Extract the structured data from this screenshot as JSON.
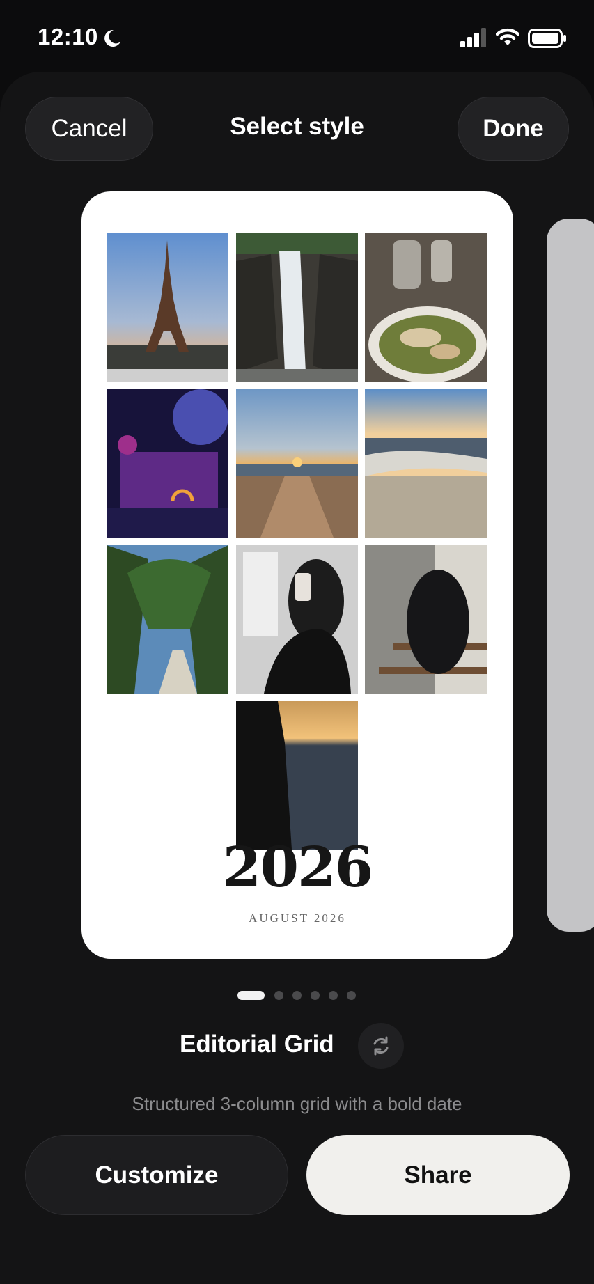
{
  "status": {
    "time": "12:10"
  },
  "header": {
    "cancel_label": "Cancel",
    "title": "Select style",
    "done_label": "Done"
  },
  "preview": {
    "year_text": "2026",
    "month_text": "AUGUST 2026",
    "photos": [
      "eiffel-tower-photo",
      "waterfall-photo",
      "dinner-salad-photo",
      "nightclub-photo",
      "beach-sunset-path-photo",
      "beach-waves-photo",
      "palm-path-photo",
      "mirror-selfie-photo",
      "staircase-portrait-photo",
      "sunset-silhouette-photo"
    ]
  },
  "pagination": {
    "count": 6,
    "active_index": 0
  },
  "style": {
    "name": "Editorial Grid",
    "description": "Structured 3-column grid with a bold date"
  },
  "actions": {
    "customize_label": "Customize",
    "share_label": "Share"
  },
  "colors": {
    "background": "#0c0c0d",
    "sheet": "#141415",
    "share_button": "#f1f0ed"
  }
}
